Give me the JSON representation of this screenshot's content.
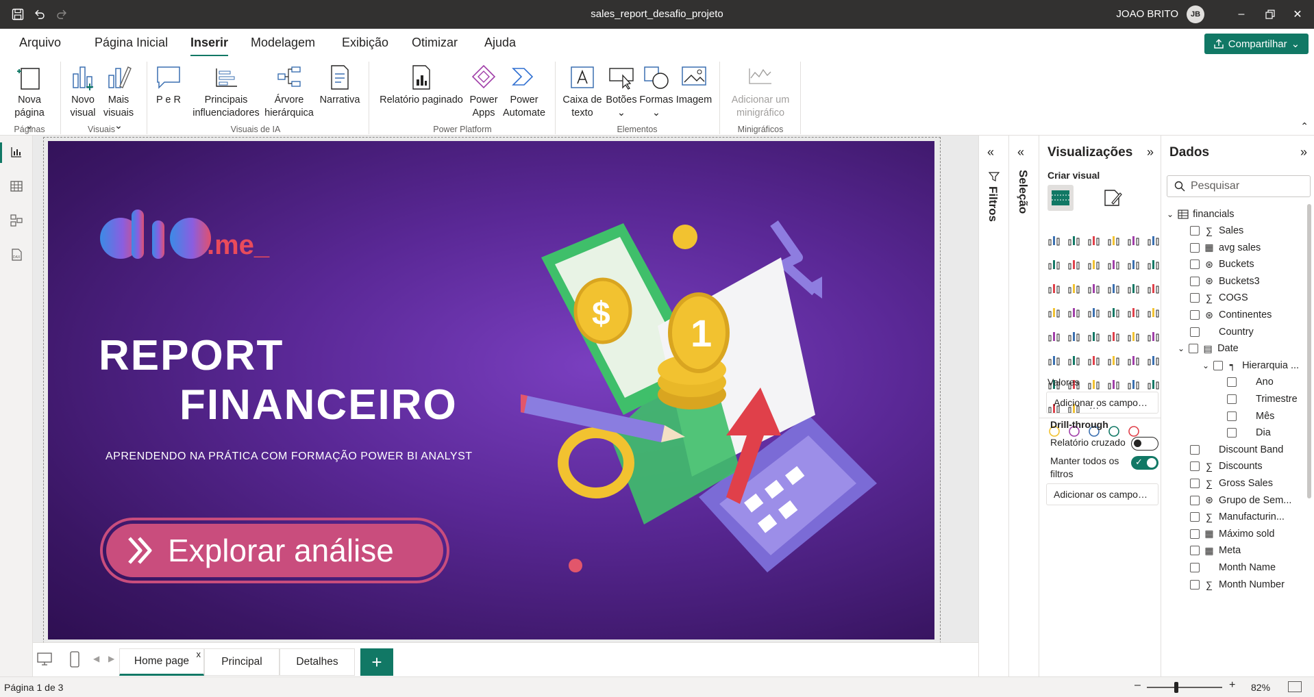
{
  "titlebar": {
    "file_name": "sales_report_desafio_projeto",
    "user_name": "JOAO BRITO",
    "user_initials": "JB"
  },
  "menu": {
    "items": [
      "Arquivo",
      "Página Inicial",
      "Inserir",
      "Modelagem",
      "Exibição",
      "Otimizar",
      "Ajuda"
    ],
    "active": "Inserir",
    "share_label": "Compartilhar"
  },
  "ribbon": {
    "buttons": [
      "Nova página",
      "Novo visual",
      "Mais visuais",
      "P e R",
      "Principais influenciadores",
      "Árvore hierárquica",
      "Narrativa",
      "Relatório paginado",
      "Power Apps",
      "Power Automate",
      "Caixa de texto",
      "Botões",
      "Formas",
      "Imagem",
      "Adicionar um minigráfico"
    ],
    "groups": [
      "Páginas",
      "Visuais",
      "Visuais de IA",
      "Power Platform",
      "Elementos",
      "Minigráficos"
    ]
  },
  "report": {
    "logo_text": "dio",
    "logo_suffix": ".me_",
    "title_line1": "REPORT",
    "title_line2": "FINANCEIRO",
    "subtitle": "APRENDENDO NA PRÁTICA  COM FORMAÇÃO POWER BI ANALYST",
    "cta": "Explorar análise"
  },
  "pages": {
    "tabs": [
      "Home page",
      "Principal",
      "Detalhes"
    ],
    "active": "Home page",
    "close_glyph": "x",
    "add_glyph": "+"
  },
  "status": {
    "page_info": "Página 1 de 3",
    "zoom": "82%"
  },
  "panes": {
    "filters": "Filtros",
    "selection": "Seleção"
  },
  "visualizations": {
    "title": "Visualizações",
    "create_visual": "Criar visual",
    "values_label": "Valores",
    "values_placeholder": "Adicionar os campos de da...",
    "drill_label": "Drill-through",
    "cross_report": "Relatório cruzado",
    "cross_report_on": false,
    "keep_filters": "Manter todos os filtros",
    "keep_filters_on": true,
    "drill_placeholder": "Adicionar os campos de dr...",
    "more_glyph": "···"
  },
  "data": {
    "title": "Dados",
    "search_placeholder": "Pesquisar",
    "table_name": "financials",
    "fields": [
      {
        "name": "Sales",
        "icon": "sigma"
      },
      {
        "name": "avg sales",
        "icon": "calc"
      },
      {
        "name": "Buckets",
        "icon": "group"
      },
      {
        "name": "Buckets3",
        "icon": "group"
      },
      {
        "name": "COGS",
        "icon": "sigma"
      },
      {
        "name": "Continentes",
        "icon": "group"
      },
      {
        "name": "Country",
        "icon": "none"
      },
      {
        "name": "Date",
        "icon": "calendar"
      },
      {
        "name": "Hierarquia ...",
        "icon": "hierarchy"
      },
      {
        "name": "Ano",
        "icon": "none"
      },
      {
        "name": "Trimestre",
        "icon": "none"
      },
      {
        "name": "Mês",
        "icon": "none"
      },
      {
        "name": "Dia",
        "icon": "none"
      },
      {
        "name": "Discount Band",
        "icon": "none"
      },
      {
        "name": "Discounts",
        "icon": "sigma"
      },
      {
        "name": "Gross Sales",
        "icon": "sigma"
      },
      {
        "name": "Grupo de Sem...",
        "icon": "group"
      },
      {
        "name": "Manufacturin...",
        "icon": "sigma"
      },
      {
        "name": "Máximo sold",
        "icon": "calc"
      },
      {
        "name": "Meta",
        "icon": "calc"
      },
      {
        "name": "Month Name",
        "icon": "none"
      },
      {
        "name": "Month Number",
        "icon": "sigma"
      }
    ]
  },
  "colors": {
    "accent": "#117865",
    "titlebar": "#323130",
    "cta": "#c94d7d",
    "report_bg": "#5a2896"
  }
}
